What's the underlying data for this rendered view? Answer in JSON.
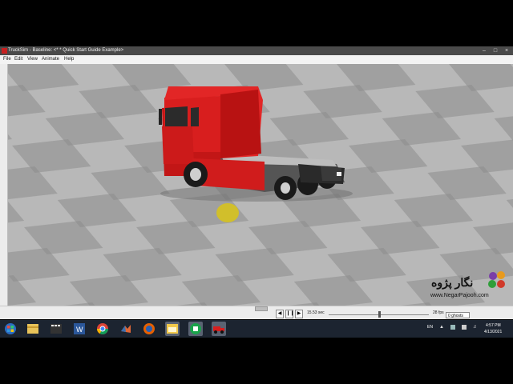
{
  "window": {
    "title": "TruckSim - Baseline: <* * Quick Start Guide Example>",
    "min_icon": "minimize-icon",
    "max_icon": "maximize-icon",
    "close_icon": "close-icon"
  },
  "menu": {
    "items": [
      "File",
      "Edit",
      "View",
      "Animate",
      "Help"
    ]
  },
  "scene": {
    "floor_light": "#b8b8b8",
    "floor_dark": "#8c8c8c",
    "truck_color": "#d81e1e",
    "marker_color": "#d6c21e"
  },
  "controls": {
    "time": "15.53 sec",
    "fps": "28 fps",
    "ghosts": "0 ghosts"
  },
  "watermark": {
    "name": "نگار پژوه",
    "url": "www.NegarPajooh.com"
  },
  "taskbar": {
    "lang": "EN",
    "time": "4:57 PM",
    "date": "4/13/2021",
    "icons": [
      "start-icon",
      "explorer-icon",
      "media-icon",
      "word-icon",
      "chrome-icon",
      "matlab-icon",
      "firefox-icon",
      "folder-icon",
      "green-app-icon",
      "trucksim-icon"
    ]
  }
}
